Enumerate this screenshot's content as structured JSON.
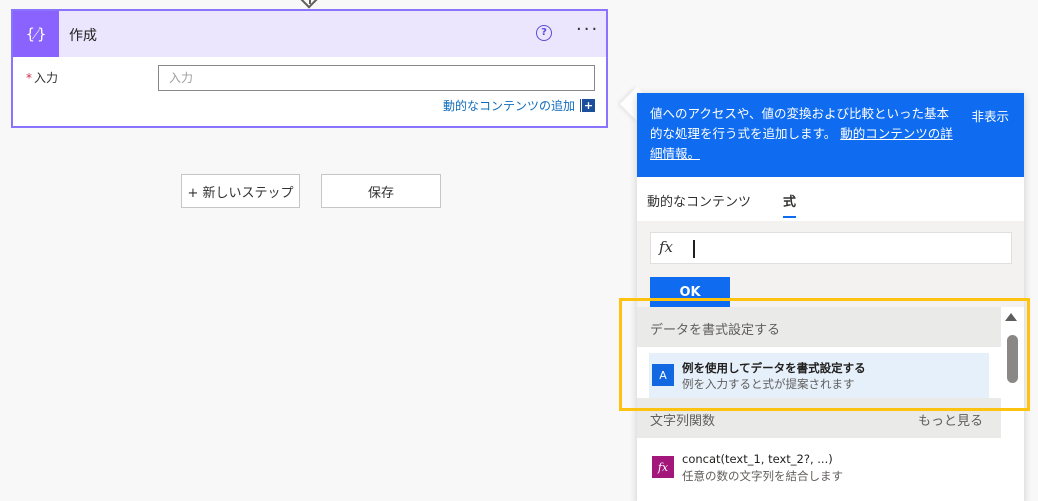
{
  "card": {
    "title": "作成",
    "icon_glyph": "{⁄}",
    "help_glyph": "?",
    "more_glyph": "···",
    "field_required_mark": "*",
    "field_label": "入力",
    "field_placeholder": "入力",
    "field_value": "",
    "add_dynamic_label": "動的なコンテンツの追加",
    "add_dynamic_glyph": "+"
  },
  "steps": {
    "new_step_label": "+ 新しいステップ",
    "save_label": "保存"
  },
  "panel": {
    "banner_text": "値へのアクセスや、値の変換および比較といった基本的な処理を行う式を追加します。",
    "banner_link": "動的コンテンツの詳細情報。",
    "hide_label": "非表示",
    "tabs": [
      {
        "label": "動的なコンテンツ",
        "active": false
      },
      {
        "label": "式",
        "active": true
      }
    ],
    "fx_glyph": "fx",
    "expression_value": "",
    "ok_label": "OK",
    "groups": [
      {
        "label": "データを書式設定する",
        "more": "",
        "items": [
          {
            "icon_glyph": "A",
            "title": "例を使用してデータを書式設定する",
            "desc": "例を入力すると式が提案されます"
          }
        ]
      },
      {
        "label": "文字列関数",
        "more": "もっと見る",
        "items": [
          {
            "icon_glyph": "fx",
            "title": "concat(text_1, text_2?, ...)",
            "desc": "任意の数の文字列を結合します"
          }
        ]
      }
    ]
  },
  "colors": {
    "card_accent": "#8a63ff",
    "banner_blue": "#0f6cf0",
    "highlight": "#ffc20e",
    "string_fn": "#a3177b"
  }
}
